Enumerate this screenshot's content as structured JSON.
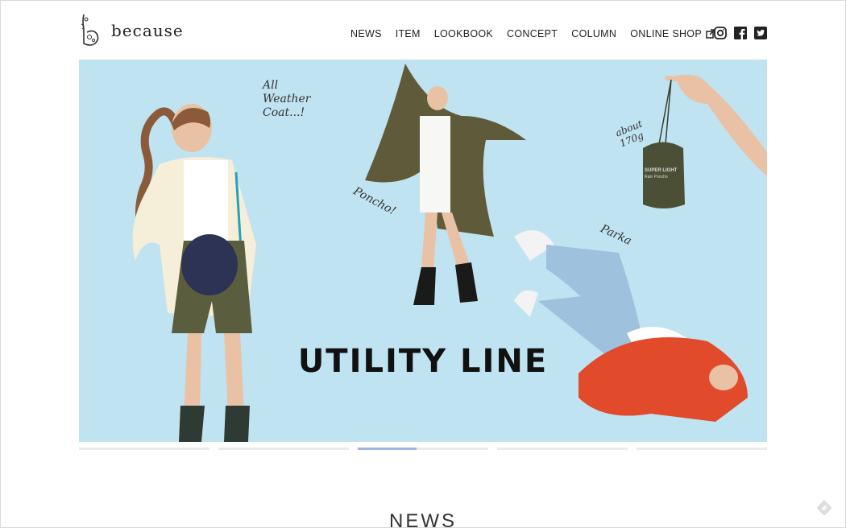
{
  "brand": {
    "logo_text": "because"
  },
  "nav": {
    "items": [
      "NEWS",
      "ITEM",
      "LOOKBOOK",
      "CONCEPT",
      "COLUMN",
      "ONLINE SHOP"
    ]
  },
  "social": [
    "instagram-icon",
    "facebook-icon",
    "twitter-icon"
  ],
  "hero": {
    "title": "UTILITY LINE",
    "annotations": {
      "coat": "All\nWeather\nCoat...!",
      "poncho": "Poncho!",
      "weight": "about\n170g",
      "parka": "Parka",
      "bag_line1": "SUPER LIGHT",
      "bag_line2": "Rain Poncho"
    },
    "background_color": "#c0e3f1"
  },
  "slider": {
    "count": 5,
    "active_index": 2,
    "active_progress": 0.45
  },
  "sections": {
    "news_heading": "NEWS"
  }
}
